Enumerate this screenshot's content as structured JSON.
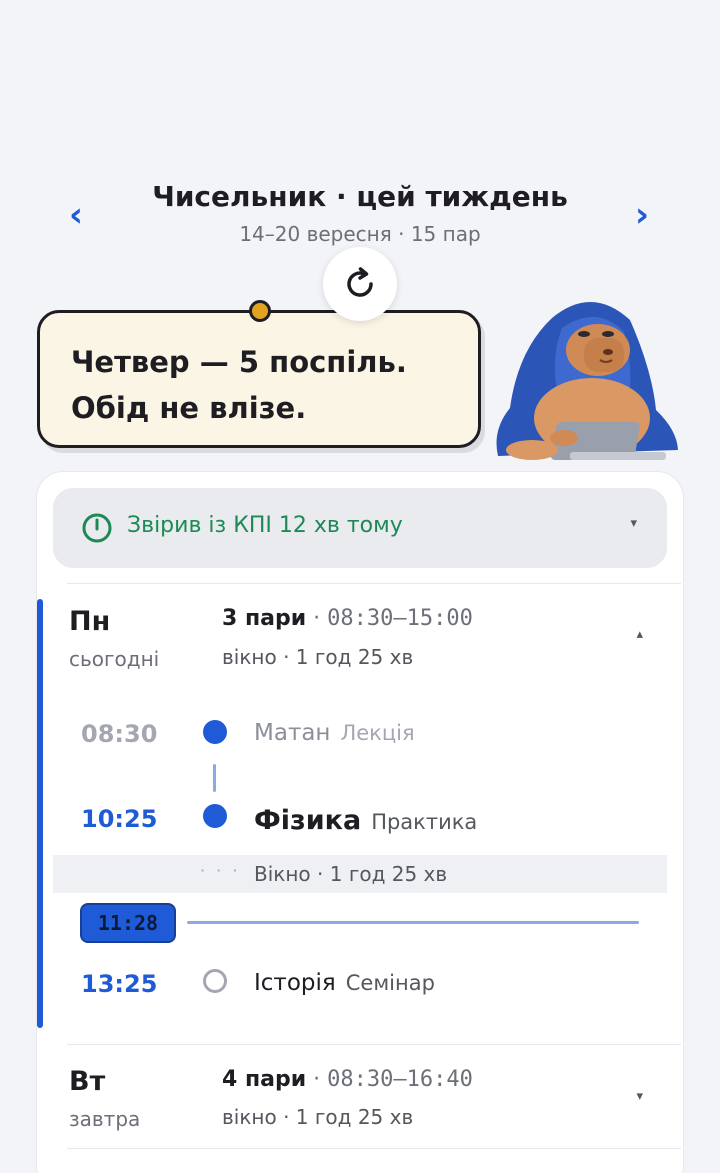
{
  "week": {
    "title": "Чисельник · цей тиждень",
    "subtitle": "14–20 вересня · 15 пар",
    "prev_icon": "‹",
    "next_icon": "›"
  },
  "bubble": {
    "line1": "Четвер — 5 поспіль.",
    "line2": "Обід не влізе."
  },
  "sync": {
    "text": "Звірив із КПІ 12 хв тому",
    "caret": "▾",
    "color": "#1d8a55"
  },
  "days": [
    {
      "name": "Пн",
      "relative": "сьогодні",
      "count": "3 пари",
      "sep": " · ",
      "range": "08:30–15:00",
      "gap": "вікно · 1 год 25 хв",
      "caret": "▴",
      "expanded": true,
      "slots": [
        {
          "time": "08:30",
          "name": "Матан",
          "type": "Лекція",
          "state": "past"
        },
        {
          "time": "10:25",
          "name": "Фізика",
          "type": "Практика",
          "state": "current"
        },
        {
          "time": "13:25",
          "name": "Історія",
          "type": "Семінар",
          "state": "upcoming"
        }
      ],
      "window": {
        "dots": "· · ·",
        "text": "Вікно · 1 год 25 хв"
      },
      "now": "11:28"
    },
    {
      "name": "Вт",
      "relative": "завтра",
      "count": "4 пари",
      "sep": " · ",
      "range": "08:30–16:40",
      "gap": "вікно · 1 год 25 хв",
      "caret": "▾",
      "expanded": false
    }
  ],
  "colors": {
    "accent": "#1f5bd6",
    "bubble_bg": "#fbf5e6",
    "bubble_dot": "#e2a322",
    "sync_green": "#1d8a55",
    "muted": "#6c6e78",
    "page_bg": "#f3f4f8"
  },
  "icons": {
    "refresh": "refresh-icon",
    "sync": "clock-check-icon",
    "mascot": "capybara-laptop-illustration"
  }
}
